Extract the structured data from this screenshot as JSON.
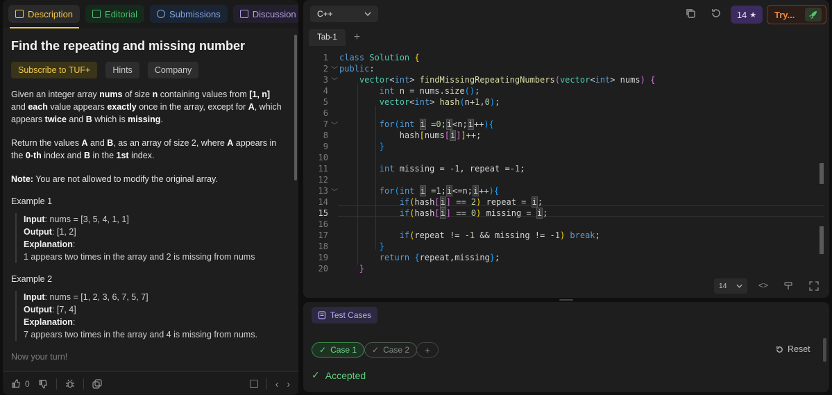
{
  "left_tabs": [
    {
      "label": "Description"
    },
    {
      "label": "Editorial"
    },
    {
      "label": "Submissions"
    },
    {
      "label": "Discussion"
    }
  ],
  "problem": {
    "title": "Find the repeating and missing number",
    "chips": [
      "Subscribe to TUF+",
      "Hints",
      "Company"
    ],
    "note_label": "Note:",
    "note_text": " You are not allowed to modify the original array.",
    "examples": [
      {
        "heading": "Example 1",
        "input_label": "Input",
        "input": ": nums = [3, 5, 4, 1, 1]",
        "output_label": "Output",
        "output": ": [1, 2]",
        "explanation_label": "Explanation",
        "explanation_colon": ":",
        "explanation": "1 appears two times in the array and 2 is missing from nums"
      },
      {
        "heading": "Example 2",
        "input_label": "Input",
        "input": ": nums = [1, 2, 3, 6, 7, 5, 7]",
        "output_label": "Output",
        "output": ": [7, 4]",
        "explanation_label": "Explanation",
        "explanation_colon": ":",
        "explanation": "7 appears two times in the array and 4 is missing from nums."
      }
    ],
    "turn": "Now your turn!"
  },
  "left_footer": {
    "likes": "0"
  },
  "editor": {
    "language": "C++",
    "streak": "14",
    "try_label": "Try...",
    "tab": "Tab-1",
    "font_size": "14",
    "lines": [
      "1",
      "2",
      "3",
      "4",
      "5",
      "6",
      "7",
      "8",
      "9",
      "10",
      "11",
      "12",
      "13",
      "14",
      "15",
      "16",
      "17",
      "18",
      "19",
      "20"
    ],
    "current_line": "15"
  },
  "tests": {
    "title": "Test Cases",
    "cases": [
      "Case 1",
      "Case 2"
    ],
    "reset": "Reset",
    "result": "Accepted"
  }
}
